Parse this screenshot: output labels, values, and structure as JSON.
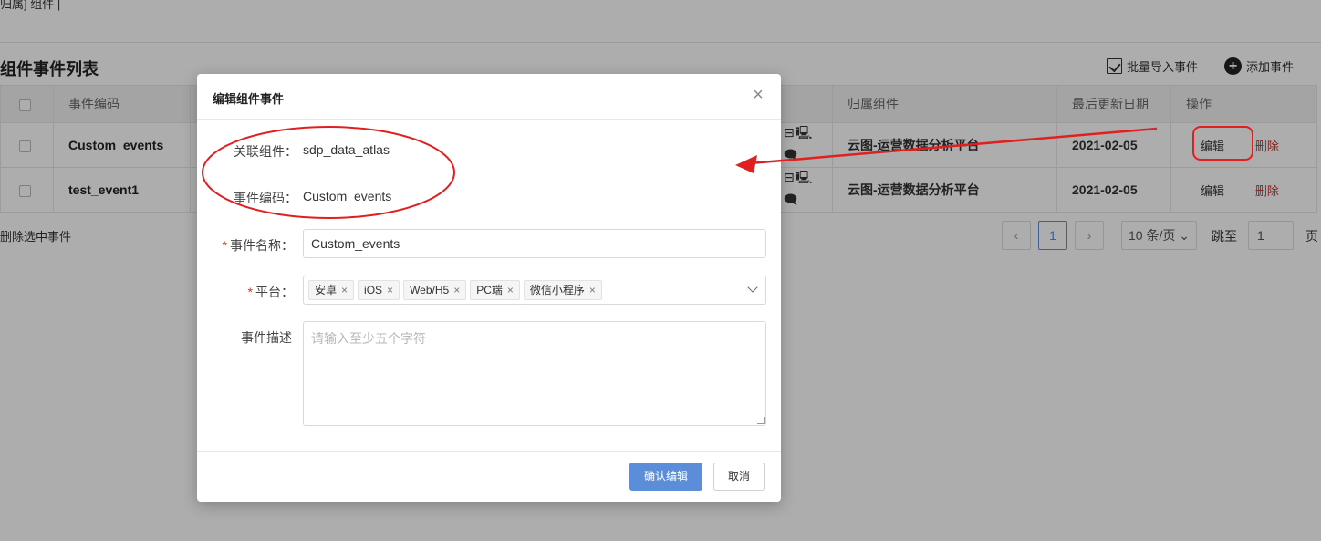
{
  "page": {
    "breadcrumb_partial": "归属] 组件 |",
    "list_title": "组件事件列表",
    "toolbar": {
      "import_label": "批量导入事件",
      "add_label": "添加事件"
    },
    "table": {
      "headers": {
        "code": "事件编码",
        "owner": "归属组件",
        "date": "最后更新日期",
        "ops": "操作"
      },
      "rows": [
        {
          "code": "Custom_events",
          "platforms": "⊟🖳🗨",
          "owner": "云图-运营数据分析平台",
          "date": "2021-02-05",
          "edit": "编辑",
          "delete": "删除"
        },
        {
          "code": "test_event1",
          "platforms": "⊟🖳🗨",
          "owner": "云图-运营数据分析平台",
          "date": "2021-02-05",
          "edit": "编辑",
          "delete": "删除"
        }
      ]
    },
    "delete_selected": "删除选中事件",
    "pagination": {
      "prev": "‹",
      "current": "1",
      "next": "›",
      "page_size": "10 条/页 ⌄",
      "jump_label": "跳至",
      "jump_value": "1",
      "page_unit": "页"
    }
  },
  "dialog": {
    "title": "编辑组件事件",
    "close_symbol": "×",
    "fields": {
      "component": {
        "label": "关联组件：",
        "value": "sdp_data_atlas"
      },
      "code": {
        "label": "事件编码：",
        "value": "Custom_events"
      },
      "name": {
        "label": "事件名称：",
        "value": "Custom_events",
        "required_mark": "*"
      },
      "platform": {
        "label": "平台：",
        "required_mark": "*",
        "tags": [
          "安卓",
          "iOS",
          "Web/H5",
          "PC端",
          "微信小程序"
        ],
        "tag_remove": "×"
      },
      "description": {
        "label": "事件描述",
        "placeholder": "请输入至少五个字符"
      }
    },
    "confirm_label": "确认编辑",
    "cancel_label": "取消"
  },
  "annotation_colors": {
    "highlight": "#e02020"
  }
}
